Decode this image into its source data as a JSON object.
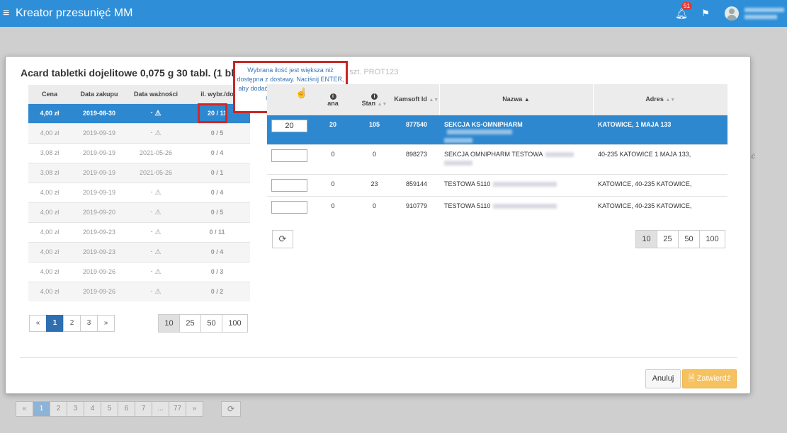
{
  "app": {
    "title": "Kreator przesunięć MM",
    "notifications": "51"
  },
  "modal": {
    "title": "Acard tabletki dojelitowe 0,075 g 30 tabl. (1 blist.po",
    "title_tail": "30 szt. PROT123",
    "tooltip": "Wybrana ilość jest większa niż dostępna z dostawy. Naciśnij ENTER, aby dodać towar z innych dostaw lub dostosuj wartość.",
    "cancel_label": "Anuluj",
    "confirm_label": "Zatwierdź"
  },
  "left_table": {
    "headers": [
      "Cena",
      "Data zakupu",
      "Data ważności",
      "il. wybr./do"
    ],
    "rows": [
      {
        "cena": "4,00 zł",
        "zakup": "2019-08-30",
        "waznosc": "-",
        "warn": true,
        "ilosc": "20 / 11"
      },
      {
        "cena": "4,00 zł",
        "zakup": "2019-09-19",
        "waznosc": "-",
        "warn": true,
        "ilosc": "0 / 5"
      },
      {
        "cena": "3,08 zł",
        "zakup": "2019-09-19",
        "waznosc": "2021-05-26",
        "warn": false,
        "ilosc": "0 / 4"
      },
      {
        "cena": "3,08 zł",
        "zakup": "2019-09-19",
        "waznosc": "2021-05-26",
        "warn": false,
        "ilosc": "0 / 1"
      },
      {
        "cena": "4,00 zł",
        "zakup": "2019-09-19",
        "waznosc": "-",
        "warn": true,
        "ilosc": "0 / 4"
      },
      {
        "cena": "4,00 zł",
        "zakup": "2019-09-20",
        "waznosc": "-",
        "warn": true,
        "ilosc": "0 / 5"
      },
      {
        "cena": "4,00 zł",
        "zakup": "2019-09-23",
        "waznosc": "-",
        "warn": true,
        "ilosc": "0 / 11"
      },
      {
        "cena": "4,00 zł",
        "zakup": "2019-09-23",
        "waznosc": "-",
        "warn": true,
        "ilosc": "0 / 4"
      },
      {
        "cena": "4,00 zł",
        "zakup": "2019-09-26",
        "waznosc": "-",
        "warn": true,
        "ilosc": "0 / 3"
      },
      {
        "cena": "4,00 zł",
        "zakup": "2019-09-26",
        "waznosc": "-",
        "warn": true,
        "ilosc": "0 / 2"
      }
    ],
    "pager": [
      "«",
      "1",
      "2",
      "3",
      "»"
    ],
    "sizes": [
      "10",
      "25",
      "50",
      "100"
    ]
  },
  "right_table": {
    "headers": {
      "wybrana": "ana",
      "stan": "Stan",
      "kamsoft": "Kamsoft Id",
      "nazwa": "Nazwa",
      "adres": "Adres"
    },
    "rows": [
      {
        "qty": "20",
        "wybrana": "20",
        "stan": "105",
        "id": "877540",
        "nazwa": "SEKCJA KS-OMNIPHARM",
        "adres": "KATOWICE, 1 MAJA 133"
      },
      {
        "qty": "",
        "wybrana": "0",
        "stan": "0",
        "id": "898273",
        "nazwa": "SEKCJA OMNIPHARM TESTOWA",
        "adres": "40-235 KATOWICE 1 MAJA 133,"
      },
      {
        "qty": "",
        "wybrana": "0",
        "stan": "23",
        "id": "859144",
        "nazwa": "TESTOWA 5110",
        "adres": "KATOWICE, 40-235 KATOWICE,"
      },
      {
        "qty": "",
        "wybrana": "0",
        "stan": "0",
        "id": "910779",
        "nazwa": "TESTOWA 5110",
        "adres": "KATOWICE, 40-235 KATOWICE,"
      }
    ],
    "sizes": [
      "10",
      "25",
      "50",
      "100"
    ]
  },
  "background": {
    "pager": [
      "«",
      "1",
      "2",
      "3",
      "4",
      "5",
      "6",
      "7",
      "...",
      "77",
      "»"
    ],
    "side_text": "ść"
  }
}
